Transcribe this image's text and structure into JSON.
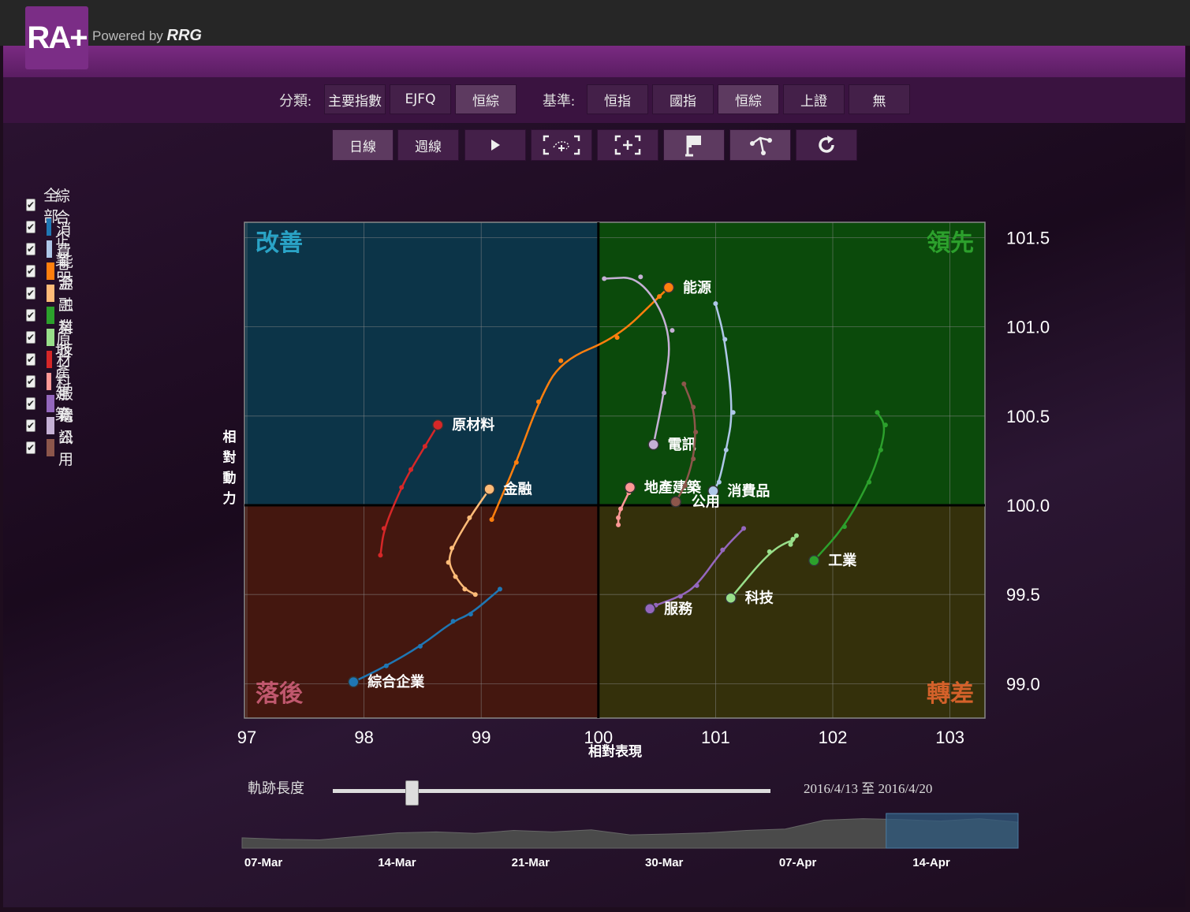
{
  "app": {
    "logo_text": "RA+",
    "powered_prefix": "Powered by ",
    "powered_brand": "RRG"
  },
  "toolbar": {
    "category_label": "分類:",
    "category_buttons": [
      "主要指數",
      "EJFQ",
      "恒綜"
    ],
    "benchmark_label": "基準:",
    "benchmark_buttons": [
      "恒指",
      "國指",
      "恒綜",
      "上證",
      "無"
    ],
    "period_buttons": [
      "日線",
      "週線"
    ],
    "tool_icons": [
      "play-icon",
      "lasso-zoom-icon",
      "box-zoom-icon",
      "flag-icon",
      "trail-icon",
      "refresh-icon"
    ]
  },
  "legend": {
    "all_label": "全部",
    "items": [
      {
        "label": "綜合企業",
        "color": "#1f77b4"
      },
      {
        "label": "消費品",
        "color": "#aec7e8"
      },
      {
        "label": "能源",
        "color": "#ff7f0e"
      },
      {
        "label": "金融",
        "color": "#ffbb78"
      },
      {
        "label": "工業",
        "color": "#2ca02c"
      },
      {
        "label": "科技",
        "color": "#98df8a"
      },
      {
        "label": "原材料",
        "color": "#d62728"
      },
      {
        "label": "地產建築",
        "color": "#ff9896"
      },
      {
        "label": "服務",
        "color": "#9467bd"
      },
      {
        "label": "電訊",
        "color": "#c5b0d5"
      },
      {
        "label": "公用",
        "color": "#8c564b"
      }
    ]
  },
  "chart_data": {
    "type": "scatter",
    "xlabel": "相對表現",
    "ylabel": "相對動力",
    "xlim": [
      97,
      103.3
    ],
    "ylim": [
      98.85,
      101.6
    ],
    "xticks": [
      "97",
      "98",
      "99",
      "100",
      "101",
      "102",
      "103"
    ],
    "yticks": [
      "101.5",
      "101.0",
      "100.5",
      "100.0",
      "99.5",
      "99.0"
    ],
    "quadrants": {
      "top_left": "改善",
      "top_right": "領先",
      "bottom_left": "落後",
      "bottom_right": "轉差"
    },
    "quadrant_colors": {
      "top_left": "#0c3448",
      "top_right": "#0b4a0b",
      "bottom_left": "#44170f",
      "bottom_right": "#34300b"
    },
    "series": [
      {
        "name": "綜合企業",
        "color": "#1f77b4",
        "points": [
          [
            99.16,
            99.53
          ],
          [
            98.91,
            99.39
          ],
          [
            98.76,
            99.35
          ],
          [
            98.48,
            99.21
          ],
          [
            98.19,
            99.1
          ],
          [
            97.91,
            99.01
          ]
        ]
      },
      {
        "name": "消費品",
        "color": "#aec7e8",
        "points": [
          [
            101.0,
            101.13
          ],
          [
            101.08,
            100.93
          ],
          [
            101.15,
            100.52
          ],
          [
            101.09,
            100.31
          ],
          [
            101.03,
            100.13
          ],
          [
            100.98,
            100.08
          ]
        ]
      },
      {
        "name": "能源",
        "color": "#ff7f0e",
        "points": [
          [
            99.09,
            99.92
          ],
          [
            99.3,
            100.24
          ],
          [
            99.49,
            100.58
          ],
          [
            99.68,
            100.81
          ],
          [
            100.16,
            100.94
          ],
          [
            100.52,
            101.17
          ],
          [
            100.6,
            101.22
          ]
        ]
      },
      {
        "name": "金融",
        "color": "#ffbb78",
        "points": [
          [
            98.95,
            99.5
          ],
          [
            98.86,
            99.53
          ],
          [
            98.78,
            99.6
          ],
          [
            98.72,
            99.68
          ],
          [
            98.75,
            99.76
          ],
          [
            98.9,
            99.93
          ],
          [
            99.07,
            100.09
          ]
        ]
      },
      {
        "name": "工業",
        "color": "#2ca02c",
        "points": [
          [
            102.38,
            100.52
          ],
          [
            102.45,
            100.45
          ],
          [
            102.41,
            100.31
          ],
          [
            102.31,
            100.13
          ],
          [
            102.1,
            99.88
          ],
          [
            101.84,
            99.69
          ]
        ]
      },
      {
        "name": "科技",
        "color": "#98df8a",
        "points": [
          [
            101.69,
            99.83
          ],
          [
            101.64,
            99.78
          ],
          [
            101.66,
            99.81
          ],
          [
            101.46,
            99.74
          ],
          [
            101.13,
            99.48
          ]
        ]
      },
      {
        "name": "原材料",
        "color": "#d62728",
        "points": [
          [
            98.14,
            99.72
          ],
          [
            98.17,
            99.87
          ],
          [
            98.32,
            100.1
          ],
          [
            98.4,
            100.2
          ],
          [
            98.52,
            100.33
          ],
          [
            98.63,
            100.45
          ]
        ]
      },
      {
        "name": "地產建築",
        "color": "#ff9896",
        "points": [
          [
            100.17,
            99.89
          ],
          [
            100.17,
            99.93
          ],
          [
            100.19,
            99.98
          ],
          [
            100.26,
            100.07
          ],
          [
            100.27,
            100.1
          ]
        ]
      },
      {
        "name": "服務",
        "color": "#9467bd",
        "points": [
          [
            101.24,
            99.87
          ],
          [
            101.06,
            99.75
          ],
          [
            100.84,
            99.55
          ],
          [
            100.7,
            99.49
          ],
          [
            100.49,
            99.44
          ],
          [
            100.44,
            99.42
          ]
        ]
      },
      {
        "name": "電訊",
        "color": "#c5b0d5",
        "points": [
          [
            100.05,
            101.27
          ],
          [
            100.36,
            101.28
          ],
          [
            100.63,
            100.98
          ],
          [
            100.56,
            100.63
          ],
          [
            100.47,
            100.34
          ]
        ]
      },
      {
        "name": "公用",
        "color": "#8c564b",
        "points": [
          [
            100.73,
            100.68
          ],
          [
            100.81,
            100.55
          ],
          [
            100.83,
            100.41
          ],
          [
            100.81,
            100.26
          ],
          [
            100.74,
            100.11
          ],
          [
            100.66,
            100.02
          ]
        ]
      }
    ]
  },
  "slider": {
    "label": "軌跡長度",
    "range_text": "2016/4/13 至 2016/4/20",
    "value_fraction": 0.18
  },
  "timeline": {
    "dates": [
      "07-Mar",
      "14-Mar",
      "21-Mar",
      "30-Mar",
      "07-Apr",
      "14-Apr"
    ],
    "values": [
      0.35,
      0.3,
      0.28,
      0.4,
      0.52,
      0.55,
      0.5,
      0.6,
      0.55,
      0.62,
      0.45,
      0.48,
      0.52,
      0.6,
      0.65,
      0.95,
      1.0,
      0.97,
      0.92,
      1.0,
      0.88
    ],
    "selection_start": 0.83
  }
}
